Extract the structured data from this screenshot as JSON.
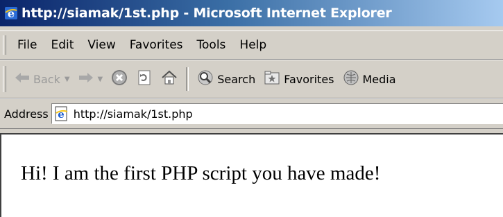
{
  "window": {
    "title": "http://siamak/1st.php - Microsoft Internet Explorer"
  },
  "menubar": {
    "items": [
      "File",
      "Edit",
      "View",
      "Favorites",
      "Tools",
      "Help"
    ]
  },
  "toolbar": {
    "back_label": "Back",
    "search_label": "Search",
    "favorites_label": "Favorites",
    "media_label": "Media"
  },
  "address": {
    "label": "Address",
    "value": "http://siamak/1st.php"
  },
  "page": {
    "text": "Hi! I am the first PHP script you have made!"
  },
  "icons": {
    "title": "ie-logo-icon",
    "back": "back-arrow-icon",
    "forward": "forward-arrow-icon",
    "stop": "stop-icon",
    "refresh": "refresh-icon",
    "home": "home-icon",
    "search": "search-icon",
    "favorites": "favorites-icon",
    "media": "media-icon",
    "address": "ie-page-icon"
  },
  "colors": {
    "titlebar_start": "#0a246a",
    "titlebar_end": "#a6caf0",
    "chrome": "#d4d0c8"
  }
}
